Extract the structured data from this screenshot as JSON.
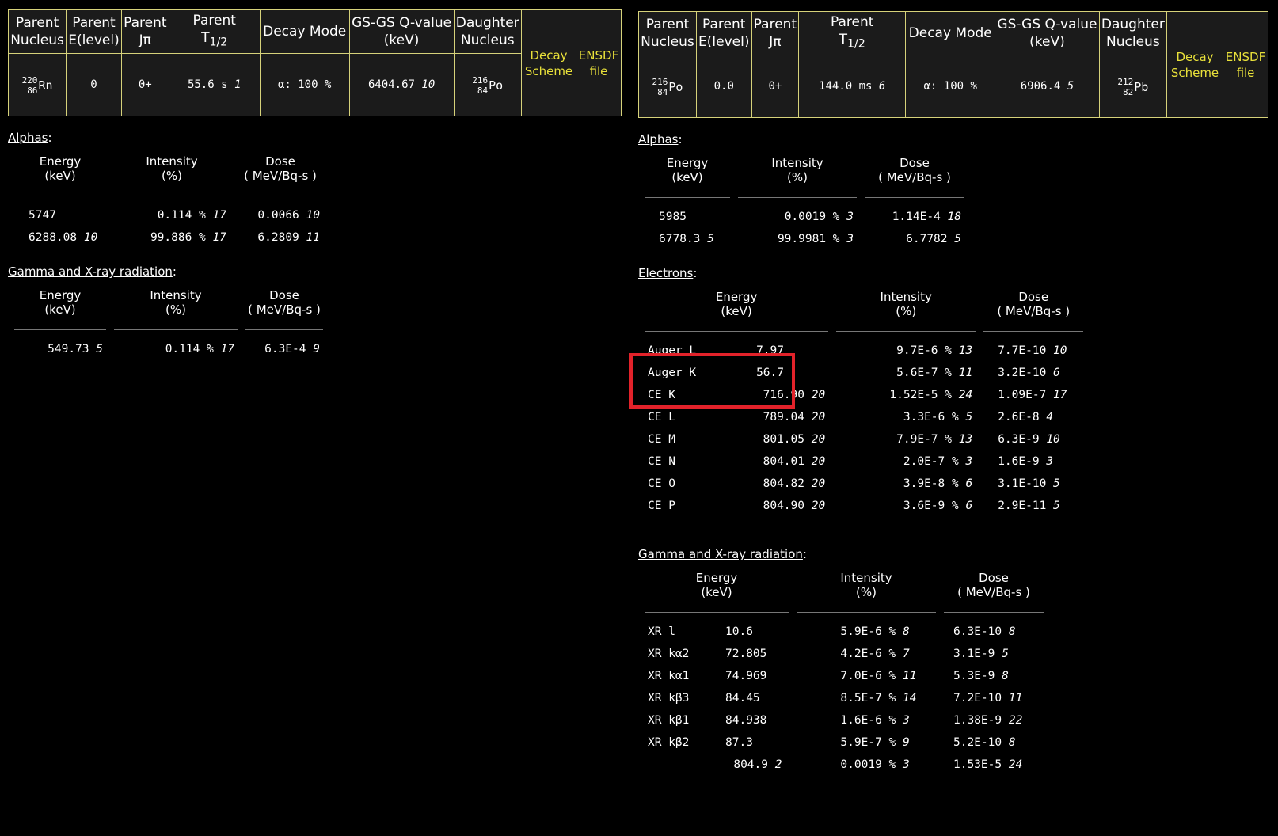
{
  "header_labels": {
    "parent_nucleus": [
      "Parent",
      "Nucleus"
    ],
    "parent_elevel": [
      "Parent",
      "E(level)"
    ],
    "parent_jpi": [
      "Parent",
      "Jπ"
    ],
    "parent_t12": [
      "Parent",
      "T",
      "1/2"
    ],
    "decay_mode": "Decay Mode",
    "qvalue": [
      "GS-GS Q-value",
      "(keV)"
    ],
    "daughter": [
      "Daughter",
      "Nucleus"
    ],
    "decay_scheme": [
      "Decay",
      "Scheme"
    ],
    "ensdf": [
      "ENSDF",
      "file"
    ]
  },
  "col_labels": {
    "energy": [
      "Energy",
      "(keV)"
    ],
    "intensity": [
      "Intensity",
      "(%)"
    ],
    "dose": [
      "Dose",
      "( MeV/Bq-s )"
    ]
  },
  "left": {
    "parent": {
      "mass": "220",
      "z": "86",
      "sym": "Rn"
    },
    "elevel": "0",
    "jpi": "0+",
    "t12": "55.6 s",
    "t12_unc": "1",
    "decay_mode": "α: 100 %",
    "qvalue": "6404.67",
    "qvalue_unc": "10",
    "daughter": {
      "mass": "216",
      "z": "84",
      "sym": "Po"
    },
    "alphas_title": "Alphas",
    "alphas": [
      {
        "energy": "5747",
        "energy_unc": "",
        "intensity": "0.114 %",
        "intensity_unc": "17",
        "dose": "0.0066",
        "dose_unc": "10"
      },
      {
        "energy": "6288.08",
        "energy_unc": "10",
        "intensity": "99.886 %",
        "intensity_unc": "17",
        "dose": "6.2809",
        "dose_unc": "11"
      }
    ],
    "gamma_title": "Gamma and X-ray radiation",
    "gammas": [
      {
        "energy": "549.73",
        "energy_unc": "5",
        "intensity": "0.114 %",
        "intensity_unc": "17",
        "dose": "6.3E-4",
        "dose_unc": "9"
      }
    ]
  },
  "right": {
    "parent": {
      "mass": "216",
      "z": "84",
      "sym": "Po"
    },
    "elevel": "0.0",
    "jpi": "0+",
    "t12": "144.0 ms",
    "t12_unc": "6",
    "decay_mode": "α: 100 %",
    "qvalue": "6906.4",
    "qvalue_unc": "5",
    "daughter": {
      "mass": "212",
      "z": "82",
      "sym": "Pb"
    },
    "alphas_title": "Alphas",
    "alphas": [
      {
        "energy": "5985",
        "energy_unc": "",
        "intensity": "0.0019 %",
        "intensity_unc": "3",
        "dose": "1.14E-4",
        "dose_unc": "18"
      },
      {
        "energy": "6778.3",
        "energy_unc": "5",
        "intensity": "99.9981 %",
        "intensity_unc": "3",
        "dose": "6.7782",
        "dose_unc": "5"
      }
    ],
    "electrons_title": "Electrons",
    "electrons": [
      {
        "type": "Auger L",
        "energy": "7.97",
        "energy_unc": "",
        "intensity": "9.7E-6 %",
        "intensity_unc": "13",
        "dose": "7.7E-10",
        "dose_unc": "10"
      },
      {
        "type": "Auger K",
        "energy": "56.7",
        "energy_unc": "",
        "intensity": "5.6E-7 %",
        "intensity_unc": "11",
        "dose": "3.2E-10",
        "dose_unc": "6"
      },
      {
        "type": "CE K",
        "energy": "716.90",
        "energy_unc": "20",
        "intensity": "1.52E-5 %",
        "intensity_unc": "24",
        "dose": "1.09E-7",
        "dose_unc": "17"
      },
      {
        "type": "CE L",
        "energy": "789.04",
        "energy_unc": "20",
        "intensity": "3.3E-6 %",
        "intensity_unc": "5",
        "dose": "2.6E-8",
        "dose_unc": "4"
      },
      {
        "type": "CE M",
        "energy": "801.05",
        "energy_unc": "20",
        "intensity": "7.9E-7 %",
        "intensity_unc": "13",
        "dose": "6.3E-9",
        "dose_unc": "10"
      },
      {
        "type": "CE N",
        "energy": "804.01",
        "energy_unc": "20",
        "intensity": "2.0E-7 %",
        "intensity_unc": "3",
        "dose": "1.6E-9",
        "dose_unc": "3"
      },
      {
        "type": "CE O",
        "energy": "804.82",
        "energy_unc": "20",
        "intensity": "3.9E-8 %",
        "intensity_unc": "6",
        "dose": "3.1E-10",
        "dose_unc": "5"
      },
      {
        "type": "CE P",
        "energy": "804.90",
        "energy_unc": "20",
        "intensity": "3.6E-9 %",
        "intensity_unc": "6",
        "dose": "2.9E-11",
        "dose_unc": "5"
      }
    ],
    "gamma_title": "Gamma and X-ray radiation",
    "gammas": [
      {
        "type": "XR l",
        "energy": "10.6",
        "energy_unc": "",
        "intensity": "5.9E-6 %",
        "intensity_unc": "8",
        "dose": "6.3E-10",
        "dose_unc": "8"
      },
      {
        "type": "XR kα2",
        "energy": "72.805",
        "energy_unc": "",
        "intensity": "4.2E-6 %",
        "intensity_unc": "7",
        "dose": "3.1E-9",
        "dose_unc": "5"
      },
      {
        "type": "XR kα1",
        "energy": "74.969",
        "energy_unc": "",
        "intensity": "7.0E-6 %",
        "intensity_unc": "11",
        "dose": "5.3E-9",
        "dose_unc": "8"
      },
      {
        "type": "XR kβ3",
        "energy": "84.45",
        "energy_unc": "",
        "intensity": "8.5E-7 %",
        "intensity_unc": "14",
        "dose": "7.2E-10",
        "dose_unc": "11"
      },
      {
        "type": "XR kβ1",
        "energy": "84.938",
        "energy_unc": "",
        "intensity": "1.6E-6 %",
        "intensity_unc": "3",
        "dose": "1.38E-9",
        "dose_unc": "22"
      },
      {
        "type": "XR kβ2",
        "energy": "87.3",
        "energy_unc": "",
        "intensity": "5.9E-7 %",
        "intensity_unc": "9",
        "dose": "5.2E-10",
        "dose_unc": "8"
      },
      {
        "type": "",
        "energy": "804.9",
        "energy_unc": "2",
        "intensity": "0.0019 %",
        "intensity_unc": "3",
        "dose": "1.53E-5",
        "dose_unc": "24"
      }
    ]
  }
}
